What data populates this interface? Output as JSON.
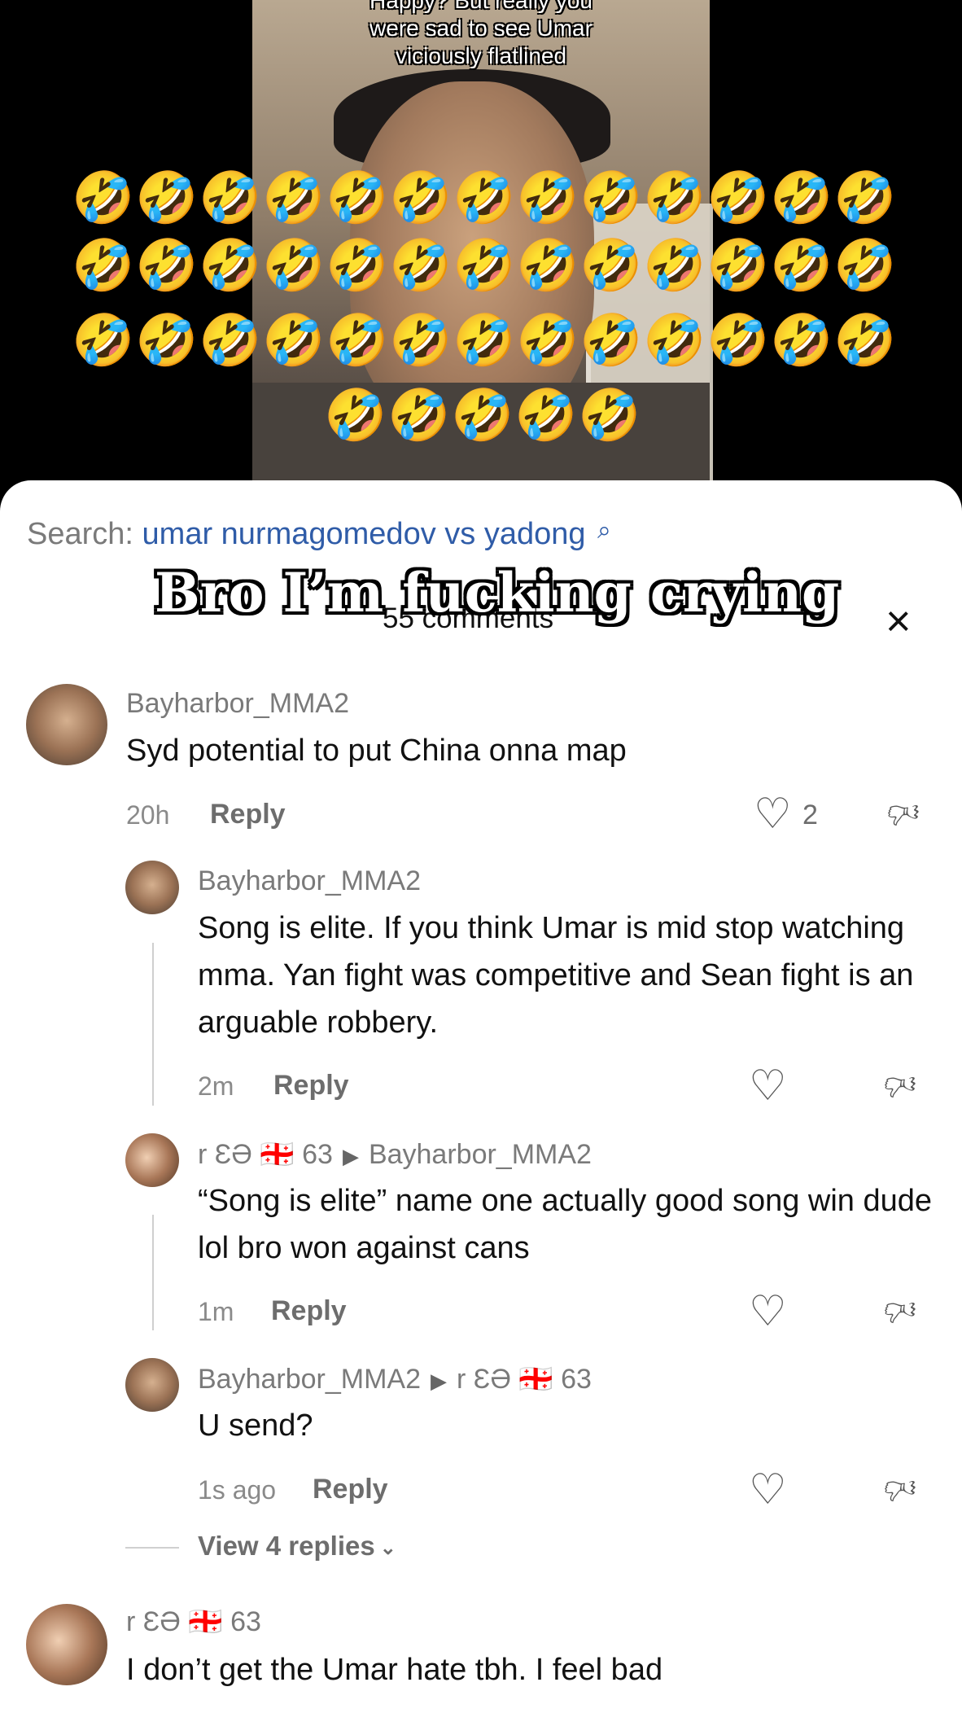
{
  "video": {
    "caption_line_0": "Happy? But really you",
    "caption_line_1": "were sad to see Umar",
    "caption_line_2": "viciously flatlined",
    "emoji": "🤣"
  },
  "search": {
    "prefix": "Search:",
    "query": "umar nurmagomedov vs yadong",
    "icon": "search-icon"
  },
  "comments_count": "55 comments",
  "overlay_text": "Bro I’m fucking crying",
  "close_icon": "×",
  "comments": [
    {
      "user": "Bayharbor_MMA2",
      "text": "Syd potential to put China onna map",
      "time": "20h",
      "reply_label": "Reply",
      "likes": "2"
    },
    {
      "user": "Bayharbor_MMA2",
      "text": "Song is elite. If you think Umar is mid stop watching mma. Yan fight was competitive and Sean fight is an arguable robbery.",
      "time": "2m",
      "reply_label": "Reply"
    },
    {
      "user": "r ƐƏ 🇬🇪 63",
      "reply_to": "Bayharbor_MMA2",
      "text": "“Song is elite” name one actually good song win dude lol bro won against cans",
      "time": "1m",
      "reply_label": "Reply"
    },
    {
      "user": "Bayharbor_MMA2",
      "reply_to": "r ƐƏ 🇬🇪 63",
      "text": "U send?",
      "time": "1s ago",
      "reply_label": "Reply"
    }
  ],
  "view_replies": "View 4 replies",
  "bottom_comment": {
    "user": "r ƐƏ 🇬🇪 63",
    "text": "I don’t get the Umar hate tbh. I feel bad"
  }
}
